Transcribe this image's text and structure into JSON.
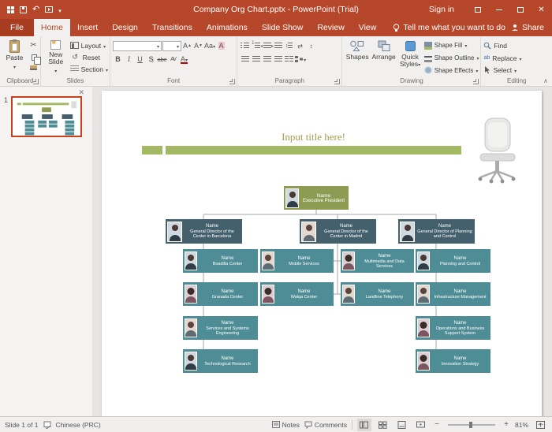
{
  "colors": {
    "accent": "#B7472A",
    "olive_box": "#8E9C53",
    "slate_box": "#45606D",
    "teal_box": "#4E8D95",
    "title_bar_green": "#A4B963"
  },
  "titlebar": {
    "title": "Company Org Chart.pptx - PowerPoint (Trial)",
    "sign_in": "Sign in"
  },
  "ribbon": {
    "tabs": [
      "File",
      "Home",
      "Insert",
      "Design",
      "Transitions",
      "Animations",
      "Slide Show",
      "Review",
      "View"
    ],
    "tell_me": "Tell me what you want to do",
    "share": "Share",
    "groups": {
      "clipboard": {
        "label": "Clipboard",
        "paste": "Paste"
      },
      "slides": {
        "label": "Slides",
        "new_slide": "New Slide",
        "layout": "Layout",
        "reset": "Reset",
        "section": "Section"
      },
      "font": {
        "label": "Font",
        "name_value": "",
        "size_value": "",
        "icons": {
          "bold": "B",
          "italic": "I",
          "underline": "U",
          "shadow": "S",
          "strike": "abc",
          "spacing": "AV",
          "case_": "Aa",
          "color": "A",
          "grow": "A",
          "shrink": "A"
        }
      },
      "paragraph": {
        "label": "Paragraph"
      },
      "drawing": {
        "label": "Drawing",
        "shapes": "Shapes",
        "arrange": "Arrange",
        "quick_styles": "Quick Styles",
        "shape_fill": "Shape Fill",
        "shape_outline": "Shape Outline",
        "shape_effects": "Shape Effects"
      },
      "editing": {
        "label": "Editing",
        "find": "Find",
        "replace": "Replace",
        "select": "Select",
        "icons": {
          "replace_glyph": "ab"
        }
      }
    }
  },
  "slide_panel": {
    "slide_number": "1"
  },
  "slide": {
    "title": "Input title here!",
    "org": {
      "root": {
        "name": "Name",
        "role": "Executive President"
      },
      "directors": [
        {
          "name": "Name",
          "role": "General Director of the Center in Barcelona"
        },
        {
          "name": "Name",
          "role": "General Director of the Center in Madrid"
        },
        {
          "name": "Name",
          "role": "General Director of Planning and Control"
        }
      ],
      "columns": [
        {
          "items": [
            {
              "name": "Name",
              "role": "Boadilla Center"
            },
            {
              "name": "Name",
              "role": "Granada Center"
            },
            {
              "name": "Name",
              "role": "Services and Systems Engineering"
            },
            {
              "name": "Name",
              "role": "Technological Research"
            }
          ]
        },
        {
          "items": [
            {
              "name": "Name",
              "role": "Mobile Services"
            },
            {
              "name": "Name",
              "role": "Walqa Center"
            }
          ]
        },
        {
          "items": [
            {
              "name": "Name",
              "role": "Multimedia and Data Services"
            },
            {
              "name": "Name",
              "role": "Landline Telephony"
            }
          ]
        },
        {
          "items": [
            {
              "name": "Name",
              "role": "Planning and Control"
            },
            {
              "name": "Name",
              "role": "Infrastructure Management"
            },
            {
              "name": "Name",
              "role": "Operations and Business Support System"
            },
            {
              "name": "Name",
              "role": "Innovation Strategy"
            }
          ]
        }
      ]
    }
  },
  "statusbar": {
    "slide_indicator": "Slide 1 of 1",
    "language": "Chinese (PRC)",
    "notes": "Notes",
    "comments": "Comments",
    "zoom_level": "81%"
  }
}
